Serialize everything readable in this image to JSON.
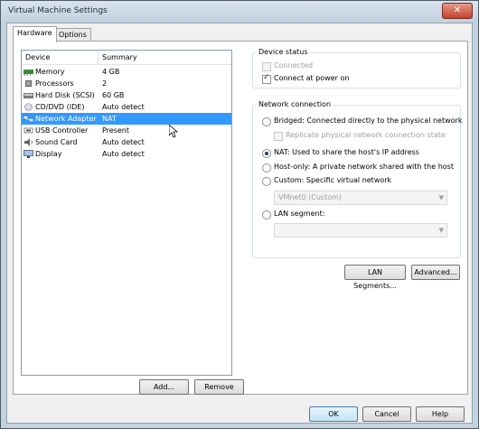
{
  "window": {
    "title": "Virtual Machine Settings",
    "close_glyph": "✕"
  },
  "tabs": [
    {
      "label": "Hardware",
      "active": true
    },
    {
      "label": "Options",
      "active": false
    }
  ],
  "device_list": {
    "columns": [
      "Device",
      "Summary"
    ],
    "rows": [
      {
        "device": "Memory",
        "summary": "4 GB",
        "icon": "memory-icon"
      },
      {
        "device": "Processors",
        "summary": "2",
        "icon": "processor-icon"
      },
      {
        "device": "Hard Disk (SCSI)",
        "summary": "60 GB",
        "icon": "hard-disk-icon"
      },
      {
        "device": "CD/DVD (IDE)",
        "summary": "Auto detect",
        "icon": "cd-dvd-icon"
      },
      {
        "device": "Network Adapter",
        "summary": "NAT",
        "icon": "network-adapter-icon",
        "selected": true
      },
      {
        "device": "USB Controller",
        "summary": "Present",
        "icon": "usb-icon"
      },
      {
        "device": "Sound Card",
        "summary": "Auto detect",
        "icon": "sound-card-icon"
      },
      {
        "device": "Display",
        "summary": "Auto detect",
        "icon": "display-icon"
      }
    ],
    "add_label": "Add...",
    "remove_label": "Remove"
  },
  "device_status": {
    "title": "Device status",
    "connected_label": "Connected",
    "connected_checked": false,
    "connected_enabled": false,
    "connect_power_label": "Connect at power on",
    "connect_power_checked": true
  },
  "network_connection": {
    "title": "Network connection",
    "bridged_label": "Bridged: Connected directly to the physical network",
    "replicate_label": "Replicate physical network connection state",
    "nat_label": "NAT: Used to share the host's IP address",
    "hostonly_label": "Host-only: A private network shared with the host",
    "custom_label": "Custom: Specific virtual network",
    "custom_value": "VMnet0 (Custom)",
    "lan_label": "LAN segment:",
    "lan_value": "",
    "selected": "nat"
  },
  "buttons": {
    "lan_segments": "LAN Segments...",
    "advanced": "Advanced...",
    "ok": "OK",
    "cancel": "Cancel",
    "help": "Help"
  }
}
